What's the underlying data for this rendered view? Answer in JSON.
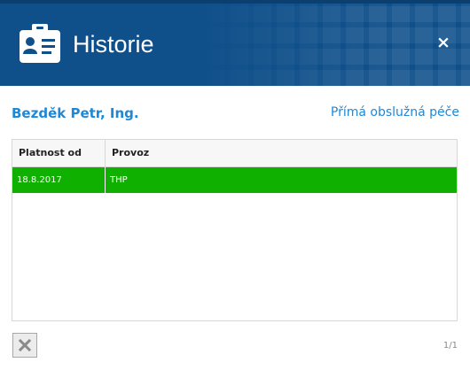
{
  "header": {
    "title": "Historie",
    "close_symbol": "×",
    "icon": "id-badge-icon",
    "bg_color": "#0f4f8a"
  },
  "subheader": {
    "person": "Bezděk Petr, Ing.",
    "category": "Přímá obslužná péče"
  },
  "table": {
    "columns": [
      "Platnost od",
      "Provoz"
    ],
    "rows": [
      {
        "platnost_od": "18.8.2017",
        "provoz": "THP",
        "highlight": "#10b000"
      }
    ]
  },
  "footer": {
    "delete_icon": "close-icon",
    "page_indicator": "1/1"
  },
  "colors": {
    "accent_text": "#1e88d6",
    "selected_row": "#10b000"
  }
}
